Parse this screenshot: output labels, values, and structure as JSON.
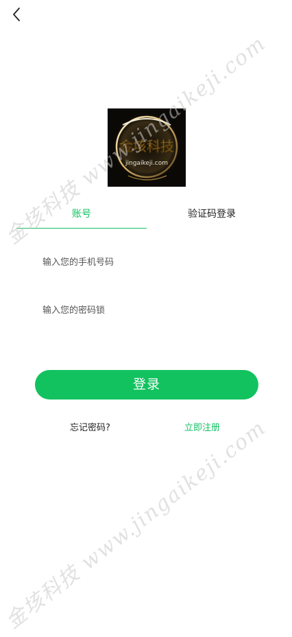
{
  "header": {
    "back_icon": "chevron-left-icon"
  },
  "logo": {
    "brand_name": "金垓科技",
    "brand_domain": "jingaikeji.com"
  },
  "tabs": [
    {
      "label": "账号",
      "active": true
    },
    {
      "label": "验证码登录",
      "active": false
    }
  ],
  "form": {
    "phone_placeholder": "输入您的手机号码",
    "password_placeholder": "输入您的密码锁",
    "login_label": "登录"
  },
  "links": {
    "forgot": "忘记密码?",
    "register": "立即注册"
  },
  "watermark": {
    "text": "金垓科技 www.jingaikeji.com"
  },
  "colors": {
    "accent": "#14c062",
    "button": "#12c25f",
    "text": "#222222",
    "placeholder": "#555555"
  }
}
